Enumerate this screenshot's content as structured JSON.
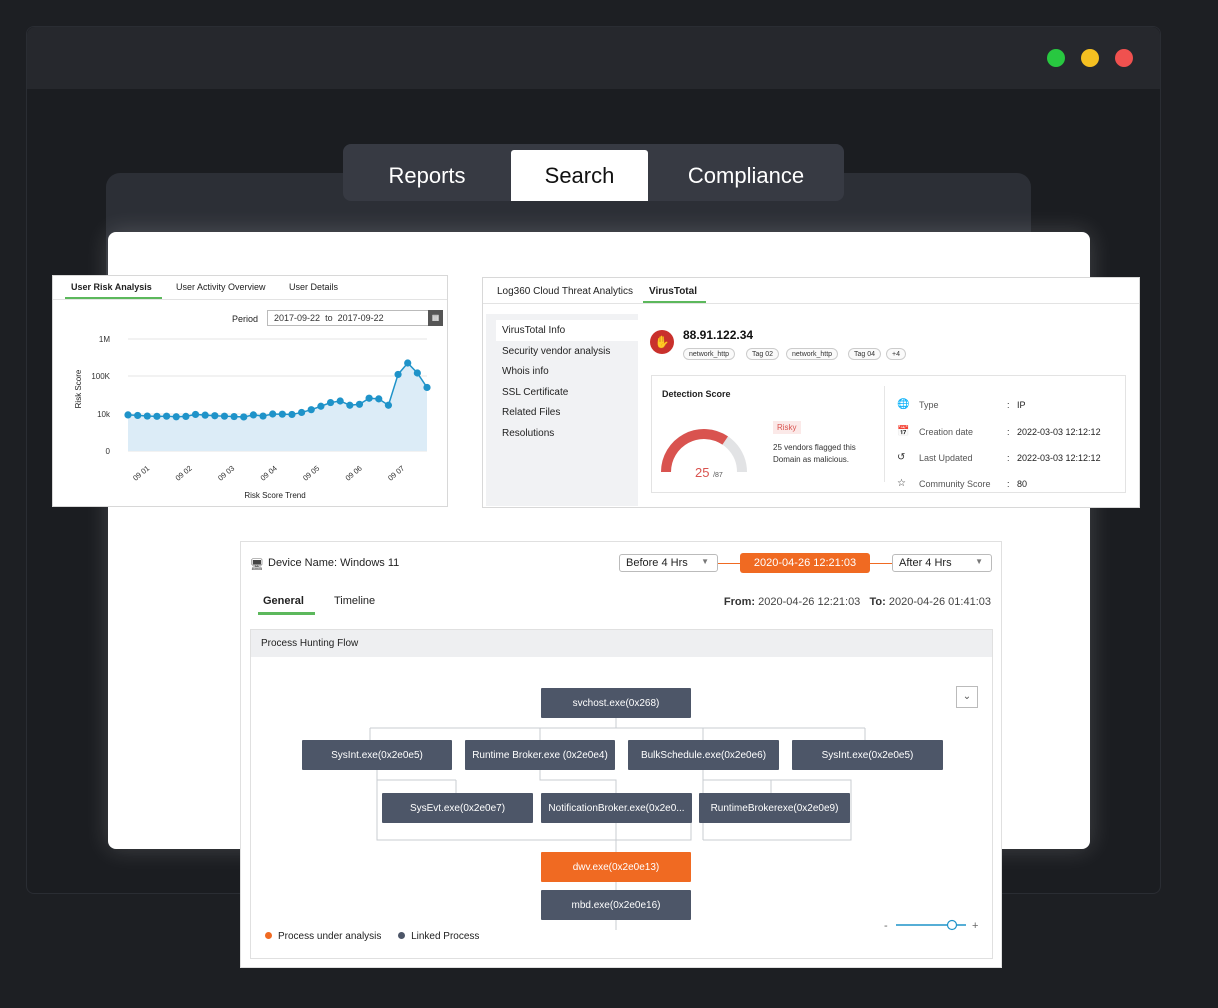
{
  "nav": {
    "tabs": [
      "Reports",
      "Search",
      "Compliance"
    ],
    "active": "Search"
  },
  "risk_card": {
    "tabs": [
      "User Risk Analysis",
      "User Activity Overview",
      "User Details"
    ],
    "period_label": "Period",
    "period_from": "2017-09-22",
    "period_to_word": "to",
    "period_to": "2017-09-22",
    "chart_title": "Risk Score Trend",
    "chart_data": {
      "type": "area",
      "xlabel": "",
      "ylabel": "Risk Score",
      "y_scale": "log",
      "y_ticks": [
        "0",
        "10k",
        "100K",
        "1M"
      ],
      "x_ticks": [
        "09 01",
        "09 02",
        "09 03",
        "09 04",
        "09 05",
        "09 06",
        "09 07"
      ],
      "grid": true,
      "values": [
        8000,
        7000,
        6000,
        5600,
        5800,
        5000,
        5500,
        9000,
        7500,
        6500,
        5800,
        5300,
        4800,
        8000,
        6000,
        10000,
        9500,
        9000,
        11000,
        13000,
        16000,
        20000,
        22000,
        17000,
        18000,
        26000,
        25000,
        17000,
        110000,
        220000,
        120000,
        50000
      ]
    }
  },
  "vt_card": {
    "tabs": [
      "Log360 Cloud Threat Analytics",
      "VirusTotal"
    ],
    "sidebar": [
      "VirusTotal Info",
      "Security vendor analysis",
      "Whois info",
      "SSL Certificate",
      "Related Files",
      "Resolutions"
    ],
    "ip": "88.91.122.34",
    "tags": [
      "network_http",
      "Tag 02",
      "network_http",
      "Tag 04",
      "+4"
    ],
    "detection_title": "Detection Score",
    "score": "25",
    "score_total": "/87",
    "score_fraction": 0.287,
    "risk_label": "Risky",
    "description": "25 vendors flagged this Domain as malicious.",
    "info": [
      {
        "label": "Type",
        "value": "IP"
      },
      {
        "label": "Creation date",
        "value": "2022-03-03 12:12:12"
      },
      {
        "label": "Last Updated",
        "value": "2022-03-03 12:12:12"
      },
      {
        "label": "Community Score",
        "value": "80"
      }
    ],
    "colors": {
      "danger": "#d9534f",
      "accent": "#5cb85c"
    }
  },
  "proc_card": {
    "device_label": "Device Name: Windows 11",
    "before": "Before 4 Hrs",
    "current": "2020-04-26  12:21:03",
    "after": "After 4 Hrs",
    "tabs": [
      "General",
      "Timeline"
    ],
    "from_label": "From:",
    "from_value": "2020-04-26  12:21:03",
    "to_label": "To:",
    "to_value": "2020-04-26  01:41:03",
    "flow_title": "Process Hunting Flow",
    "nodes": {
      "root": "svchost.exe(0x268)",
      "l1": [
        "SysInt.exe(0x2e0e5)",
        "Runtime Broker.exe (0x2e0e4)",
        "BulkSchedule.exe(0x2e0e6)",
        "SysInt.exe(0x2e0e5)"
      ],
      "l2": [
        "SysEvt.exe(0x2e0e7)",
        "NotificationBroker.exe(0x2e0...",
        "RuntimeBrokerexe(0x2e0e9)"
      ],
      "target": "dwv.exe(0x2e0e13)",
      "child": "mbd.exe(0x2e0e16)"
    },
    "legend": [
      "Process under analysis",
      "Linked Process"
    ],
    "colors": {
      "highlight": "#f06a22",
      "node": "#4d5668"
    },
    "zoom_minus": "-",
    "zoom_plus": "+",
    "zoom_level": 0.8
  }
}
